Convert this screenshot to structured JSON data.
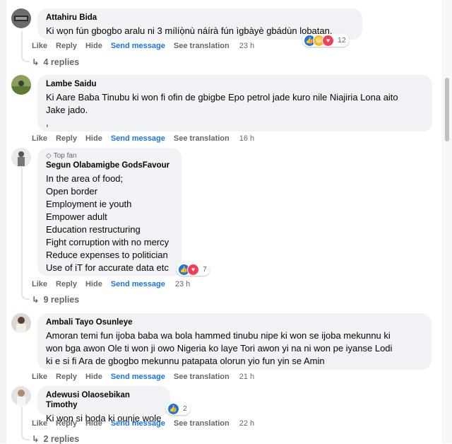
{
  "actions": {
    "like": "Like",
    "reply": "Reply",
    "hide": "Hide",
    "send_message": "Send message",
    "see_translation": "See translation"
  },
  "comments": [
    {
      "author": "Attahiru Bida",
      "text": "Ki wọn fún gbogbo aralu ni 3 mílíọ̀nù náírà fún ìgbàyè gbádùn lobatan.",
      "time": "23 h",
      "reaction_count": "12",
      "reactions": [
        "like-icon",
        "haha-icon",
        "love-icon"
      ],
      "replies": "4 replies"
    },
    {
      "author": "Lambe Saidu",
      "text": "Ki Aare Baba Tinubu ki won fi ofin de gbigbe Epo petrol jade kuro nile Niajiria Lona aito\nJake jado.\n,",
      "time": "16 h"
    },
    {
      "badge": "Top fan",
      "author": "Segun Olabamigbe GodsFavour",
      "text": "In the area of food;\nOpen border\nEmployment ie youth\nEmpower adult\nEducation restructuring\nFight corruption with no mercy\nReduce expenses to politician\nUse of iT for accurate data etc",
      "time": "23 h",
      "reaction_count": "7",
      "reactions": [
        "like-icon",
        "love-icon"
      ],
      "replies": "9 replies"
    },
    {
      "author": "Ambali Tayo Osunleye",
      "text": "Amoran temi fun ijoba baba wa bola hammed tinubu nipe ki won se ijoba mekunnu ki\nwon bga awon Ole ti won ji owo Nigeria ko laye Tori awon yi na ni won pe iyanse Lodi\nki e si fi Ara de gbogbo mekunnu patapata olorun yio fun yin se Amin",
      "time": "21 h"
    },
    {
      "author": "Adewusi Olaosebikan Timothy",
      "text": "Ki won si boda ki ounje wole",
      "time": "22 h",
      "reaction_count": "2",
      "reactions": [
        "like-icon"
      ],
      "replies": "2 replies"
    }
  ]
}
